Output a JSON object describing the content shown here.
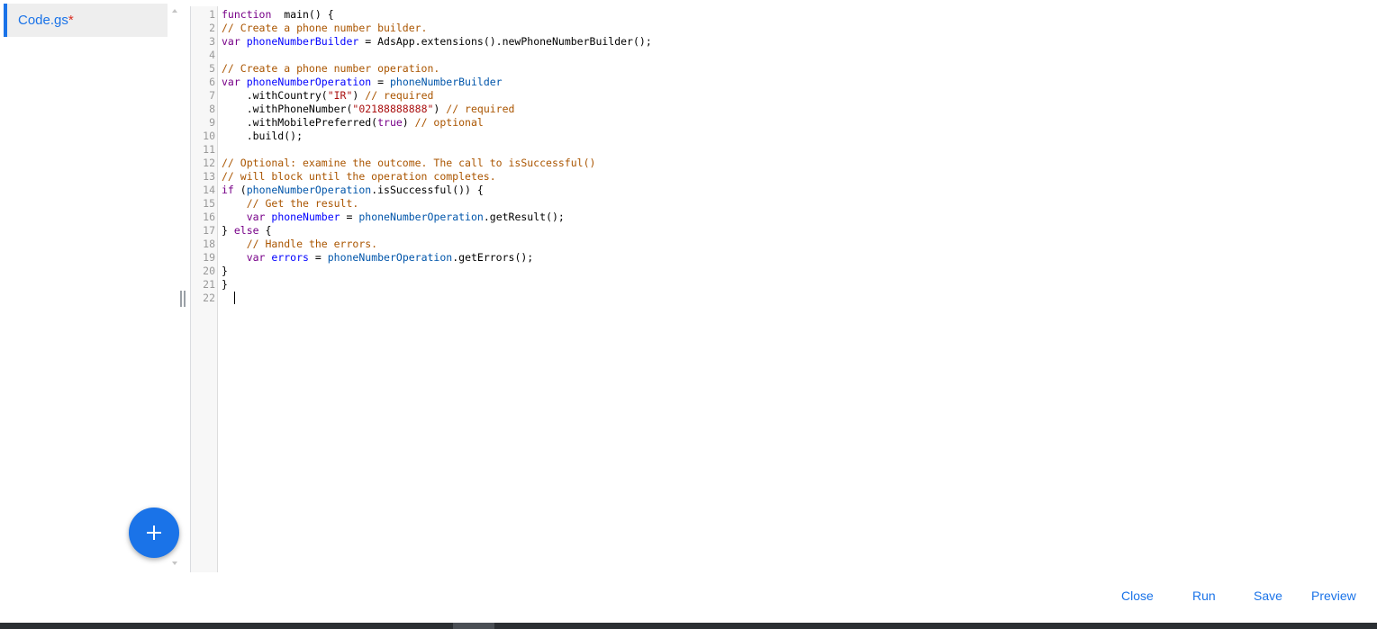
{
  "sidebar": {
    "file_name": "Code.gs",
    "modified_marker": "*",
    "add_button_icon": "plus-icon"
  },
  "editor": {
    "lines": [
      [
        [
          "kw",
          "function"
        ],
        [
          "",
          "  main() {"
        ]
      ],
      [
        [
          "cm",
          "// Create a phone number builder."
        ]
      ],
      [
        [
          "kw",
          "var"
        ],
        [
          "",
          ""
        ],
        [
          "vd",
          " phoneNumberBuilder"
        ],
        [
          "",
          ""
        ],
        [
          "",
          " = AdsApp.extensions().newPhoneNumberBuilder();"
        ]
      ],
      [],
      [
        [
          "cm",
          "// Create a phone number operation."
        ]
      ],
      [
        [
          "kw",
          "var"
        ],
        [
          "vd",
          " phoneNumberOperation"
        ],
        [
          "",
          " = "
        ],
        [
          "vv",
          "phoneNumberBuilder"
        ]
      ],
      [
        [
          "",
          "    .withCountry("
        ],
        [
          "str",
          "\"IR\""
        ],
        [
          "",
          ") "
        ],
        [
          "cm",
          "// required"
        ]
      ],
      [
        [
          "",
          "    .withPhoneNumber("
        ],
        [
          "str",
          "\"02188888888\""
        ],
        [
          "",
          ") "
        ],
        [
          "cm",
          "// required"
        ]
      ],
      [
        [
          "",
          "    .withMobilePreferred("
        ],
        [
          "kw",
          "true"
        ],
        [
          "",
          ") "
        ],
        [
          "cm",
          "// optional"
        ]
      ],
      [
        [
          "",
          "    .build();"
        ]
      ],
      [],
      [
        [
          "cm",
          "// Optional: examine the outcome. The call to isSuccessful()"
        ]
      ],
      [
        [
          "cm",
          "// will block until the operation completes."
        ]
      ],
      [
        [
          "kw",
          "if"
        ],
        [
          "",
          " ("
        ],
        [
          "vv",
          "phoneNumberOperation"
        ],
        [
          "",
          ".isSuccessful()) {"
        ]
      ],
      [
        [
          "",
          "    "
        ],
        [
          "cm",
          "// Get the result."
        ]
      ],
      [
        [
          "",
          "    "
        ],
        [
          "kw",
          "var"
        ],
        [
          "vd",
          " phoneNumber"
        ],
        [
          "",
          " = "
        ],
        [
          "vv",
          "phoneNumberOperation"
        ],
        [
          "",
          ".getResult();"
        ]
      ],
      [
        [
          "",
          "} "
        ],
        [
          "kw",
          "else"
        ],
        [
          "",
          " {"
        ]
      ],
      [
        [
          "",
          "    "
        ],
        [
          "cm",
          "// Handle the errors."
        ]
      ],
      [
        [
          "",
          "    "
        ],
        [
          "kw",
          "var"
        ],
        [
          "vd",
          " errors"
        ],
        [
          "",
          " = "
        ],
        [
          "vv",
          "phoneNumberOperation"
        ],
        [
          "",
          ".getErrors();"
        ]
      ],
      [
        [
          "",
          "}"
        ]
      ],
      [
        [
          "",
          "}"
        ]
      ],
      []
    ]
  },
  "footer": {
    "close_label": "Close",
    "run_label": "Run",
    "save_label": "Save",
    "preview_label": "Preview"
  },
  "colors": {
    "accent": "#1a73e8",
    "keyword": "#770088",
    "variable_def": "#0000ff",
    "variable": "#0055aa",
    "string": "#aa1111",
    "comment": "#aa5500"
  }
}
